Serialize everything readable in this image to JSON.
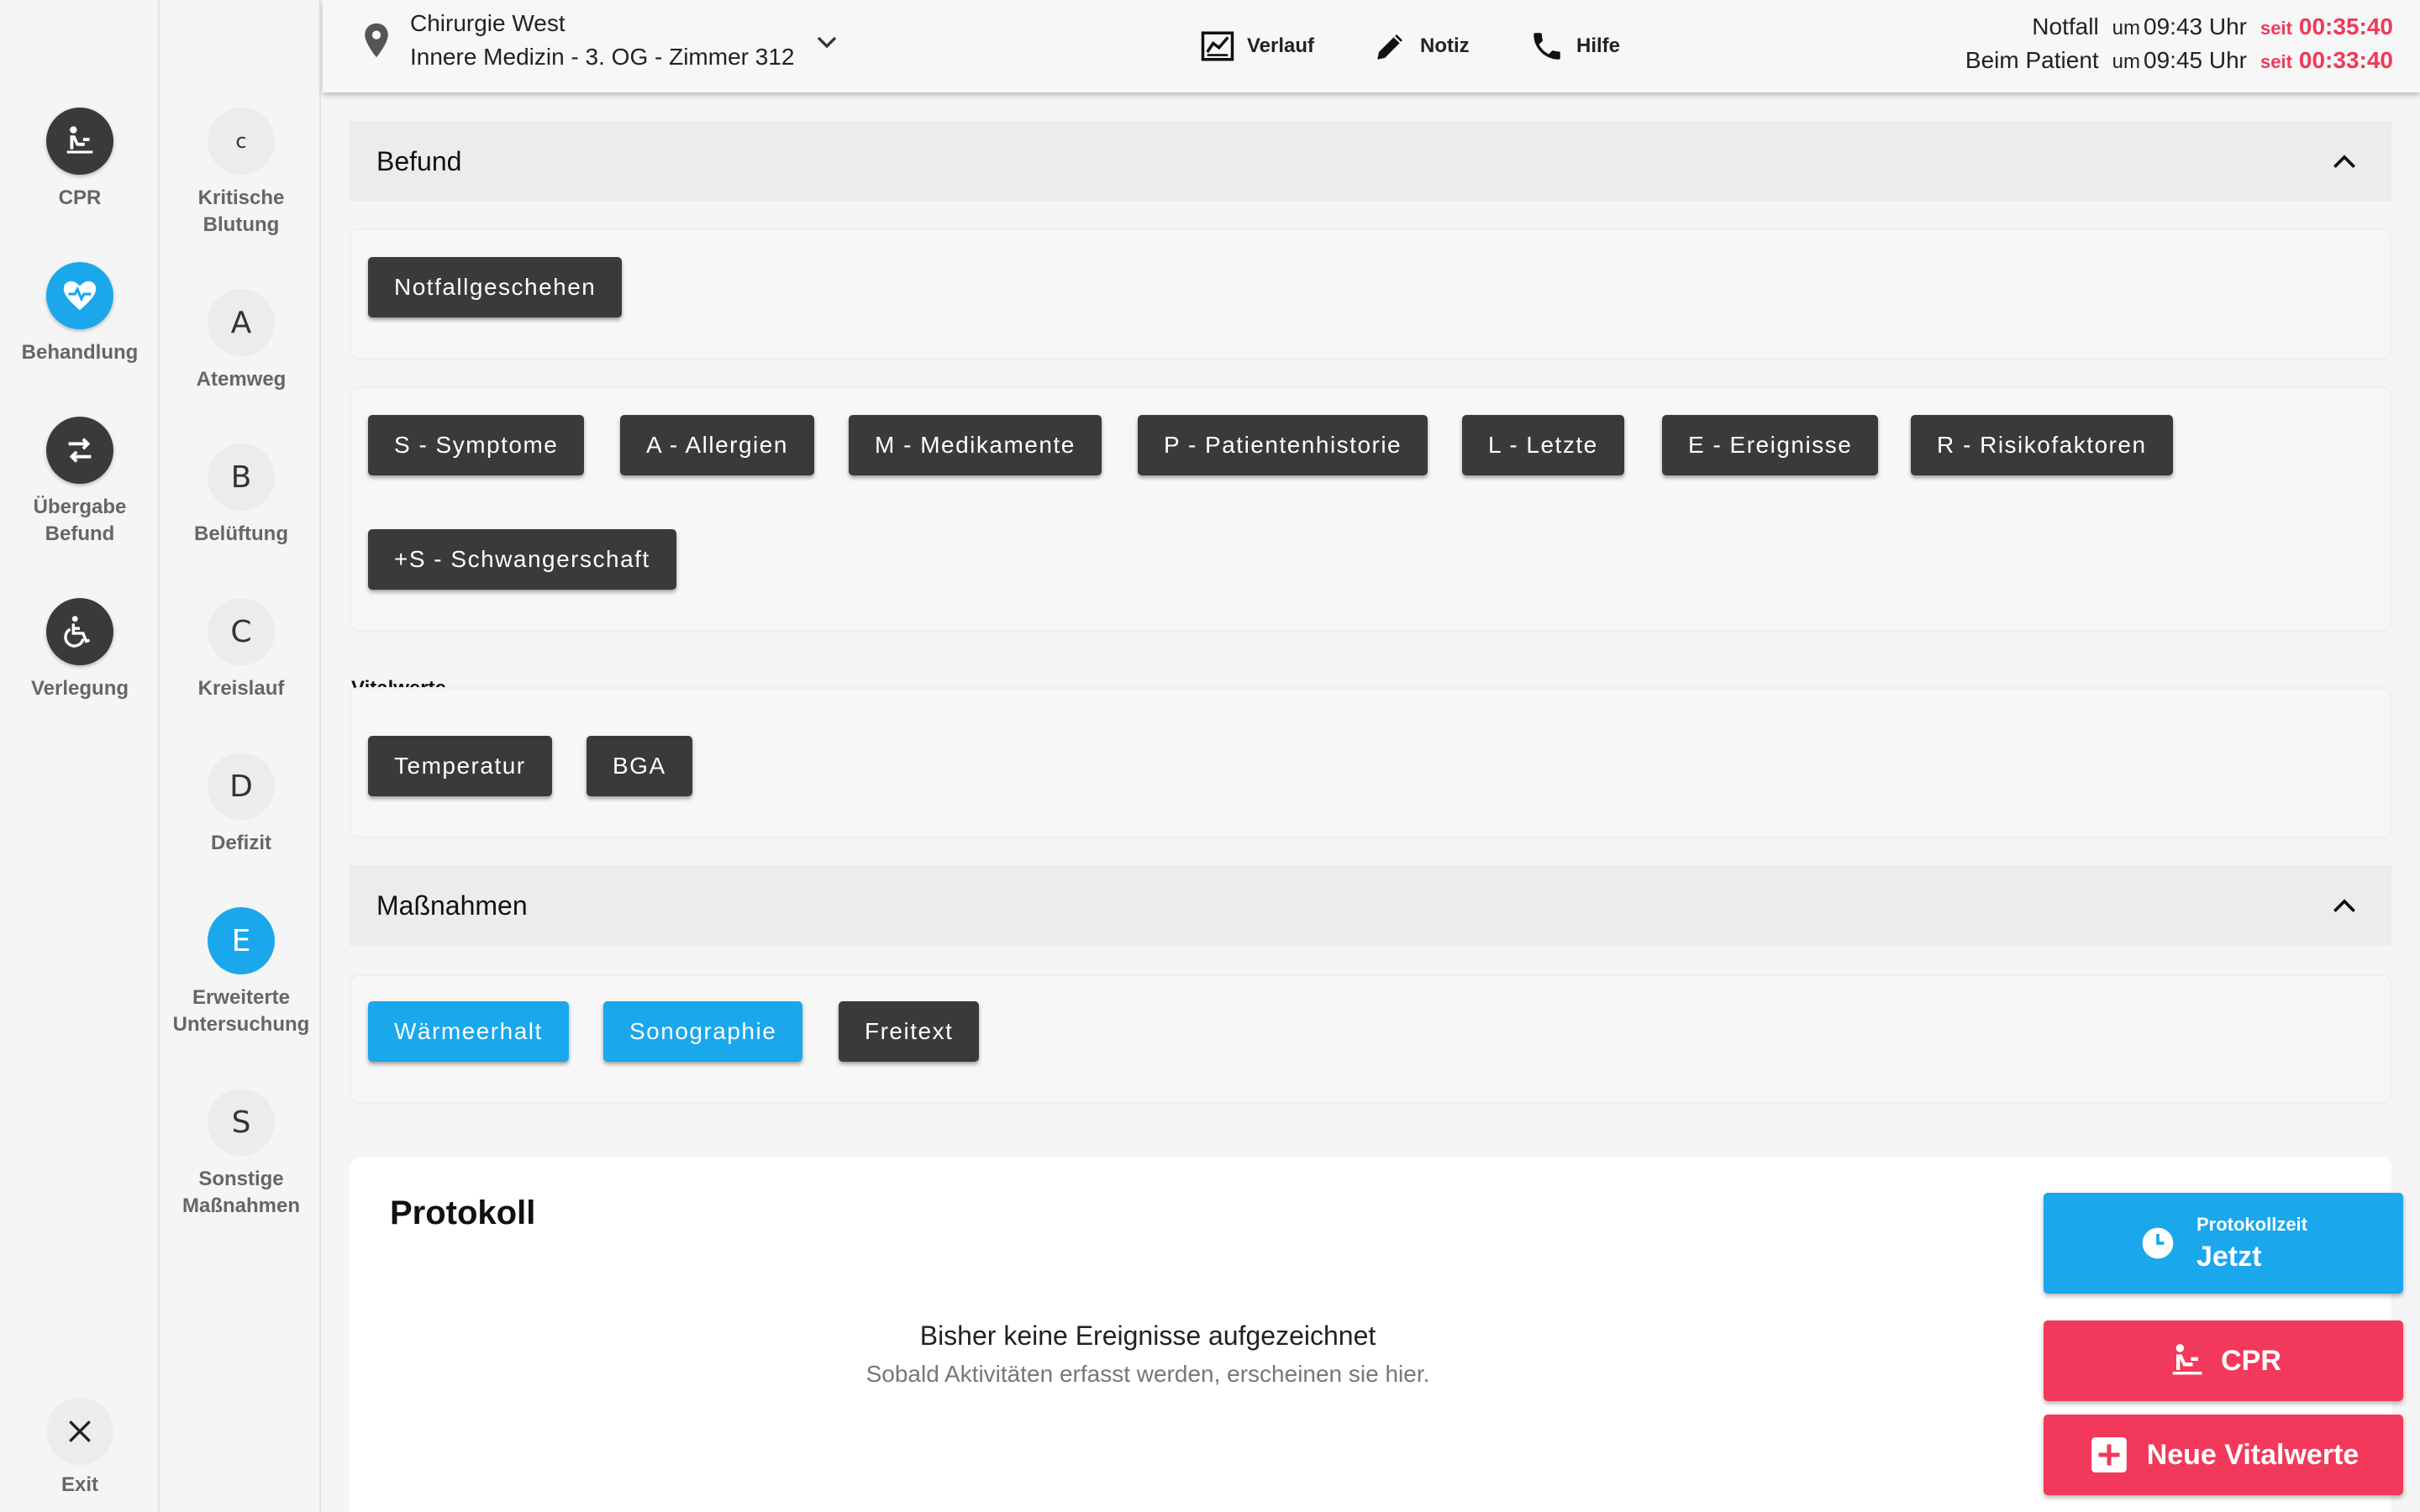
{
  "nav_main": {
    "items": [
      {
        "label": "CPR",
        "icon": "cpr-icon"
      },
      {
        "label": "Behandlung",
        "icon": "heart-pulse-icon"
      },
      {
        "label_line1": "Übergabe",
        "label_line2": "Befund",
        "icon": "swap-arrows-icon"
      },
      {
        "label": "Verlegung",
        "icon": "wheelchair-icon"
      }
    ],
    "exit_label": "Exit"
  },
  "nav_abcde": {
    "items": [
      {
        "letter": "c",
        "line1": "Kritische",
        "line2": "Blutung"
      },
      {
        "letter": "A",
        "line1": "Atemweg",
        "line2": ""
      },
      {
        "letter": "B",
        "line1": "Belüftung",
        "line2": ""
      },
      {
        "letter": "C",
        "line1": "Kreislauf",
        "line2": ""
      },
      {
        "letter": "D",
        "line1": "Defizit",
        "line2": ""
      },
      {
        "letter": "E",
        "line1": "Erweiterte",
        "line2": "Untersuchung"
      },
      {
        "letter": "S",
        "line1": "Sonstige",
        "line2": "Maßnahmen"
      }
    ]
  },
  "header": {
    "location_line1": "Chirurgie West",
    "location_line2": "Innere Medizin - 3. OG - Zimmer 312",
    "buttons": {
      "verlauf": "Verlauf",
      "notiz": "Notiz",
      "hilfe": "Hilfe"
    },
    "times": [
      {
        "label": "Notfall",
        "um": "um",
        "clock": "09:43 Uhr",
        "seit": "seit",
        "duration": "00:35:40"
      },
      {
        "label": "Beim Patient",
        "um": "um",
        "clock": "09:45 Uhr",
        "seit": "seit",
        "duration": "00:33:40"
      }
    ]
  },
  "befund": {
    "title": "Befund",
    "notfall_button": "Notfallgeschehen",
    "sampler": [
      "S - Symptome",
      "A - Allergien",
      "M - Medikamente",
      "P - Patientenhistorie",
      "L - Letzte",
      "E - Ereignisse",
      "R - Risikofaktoren",
      "+S - Schwangerschaft"
    ],
    "vital_title": "Vitalwerte",
    "vital_buttons": [
      "Temperatur",
      "BGA"
    ]
  },
  "massnahmen": {
    "title": "Maßnahmen",
    "buttons": [
      "Wärmeerhalt",
      "Sonographie",
      "Freitext"
    ]
  },
  "protokoll": {
    "title": "Protokoll",
    "empty_title": "Bisher keine Ereignisse aufgezeichnet",
    "empty_sub": "Sobald Aktivitäten erfasst werden, erscheinen sie hier."
  },
  "actions": {
    "protokollzeit_label": "Protokollzeit",
    "protokollzeit_value": "Jetzt",
    "cpr": "CPR",
    "neue_vitalwerte": "Neue Vitalwerte"
  },
  "colors": {
    "accent": "#1aa7ec",
    "danger": "#f2395b",
    "timer": "#ee3a58",
    "button_dark": "#3a3a3a"
  }
}
